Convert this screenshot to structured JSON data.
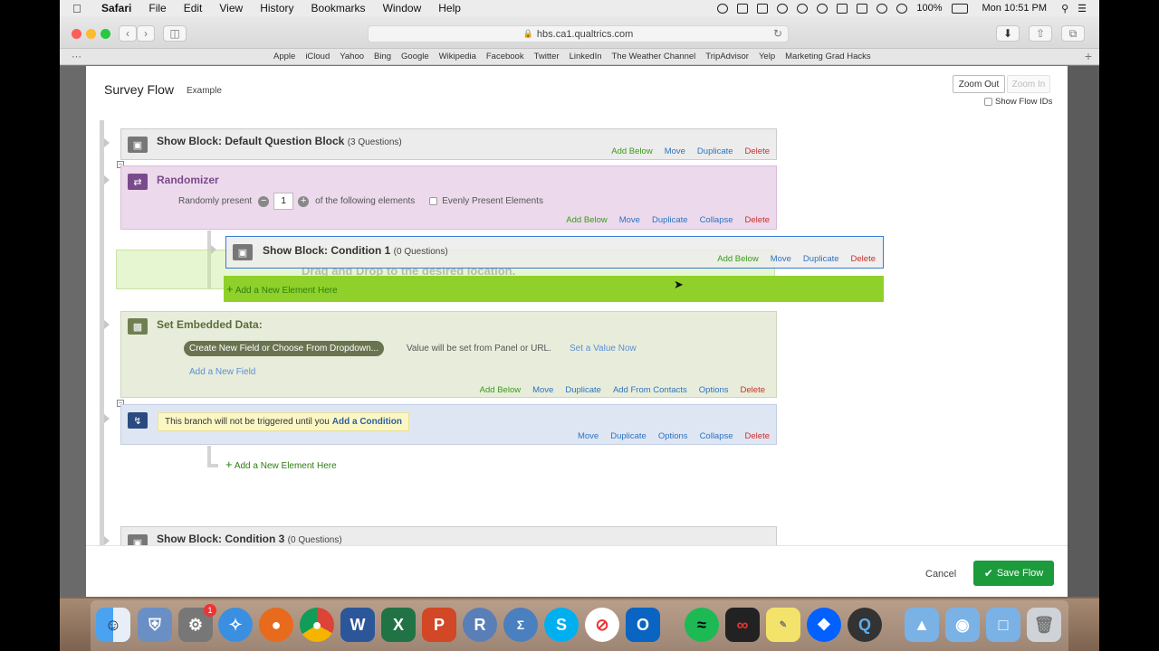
{
  "menubar": {
    "app": "Safari",
    "items": [
      "File",
      "Edit",
      "View",
      "History",
      "Bookmarks",
      "Window",
      "Help"
    ],
    "battery": "100%",
    "clock": "Mon 10:51 PM"
  },
  "browser": {
    "url": "hbs.ca1.qualtrics.com",
    "favorites": [
      "Apple",
      "iCloud",
      "Yahoo",
      "Bing",
      "Google",
      "Wikipedia",
      "Facebook",
      "Twitter",
      "LinkedIn",
      "The Weather Channel",
      "TripAdvisor",
      "Yelp",
      "Marketing Grad Hacks"
    ]
  },
  "modal": {
    "title": "Survey Flow",
    "subtitle": "Example",
    "zoom_out": "Zoom Out",
    "zoom_in": "Zoom In",
    "show_flow_ids": "Show Flow IDs",
    "cancel": "Cancel",
    "save": "Save Flow"
  },
  "flow": {
    "default_block": {
      "title": "Show Block: Default Question Block",
      "count": "(3 Questions)",
      "actions": [
        "Add Below",
        "Move",
        "Duplicate",
        "Delete"
      ]
    },
    "randomizer": {
      "title": "Randomizer",
      "present_label": "Randomly present",
      "present_value": "1",
      "following": "of the following elements",
      "evenly": "Evenly Present Elements",
      "actions": [
        "Add Below",
        "Move",
        "Duplicate",
        "Collapse",
        "Delete"
      ]
    },
    "condition1": {
      "title": "Show Block: Condition 1",
      "count": "(0 Questions)",
      "actions": [
        "Add Below",
        "Move",
        "Duplicate",
        "Delete"
      ],
      "drag_hint": "Drag and Drop to the desired location."
    },
    "add_element": "Add a New Element Here",
    "embedded": {
      "title": "Set Embedded Data:",
      "field_pill": "Create New Field or Choose From Dropdown...",
      "value_text": "Value will be set from Panel or URL.",
      "set_value": "Set a Value Now",
      "add_field": "Add a New Field",
      "actions": [
        "Add Below",
        "Move",
        "Duplicate",
        "Add From Contacts",
        "Options",
        "Delete"
      ]
    },
    "branch": {
      "notice": "This branch will not be triggered until you",
      "add_condition": "Add a Condition",
      "actions": [
        "Move",
        "Duplicate",
        "Options",
        "Collapse",
        "Delete"
      ]
    },
    "add_element_2": "Add a New Element Here",
    "condition3": {
      "title": "Show Block: Condition 3",
      "count": "(0 Questions)"
    }
  },
  "dock": {
    "badge": "1"
  },
  "colors": {
    "randomizer_bg": "#ecd9ec",
    "embedded_bg": "#e8eddb",
    "branch_bg": "#dfe6f3",
    "drop_green": "#8fd12a",
    "save_green": "#1c9b3c"
  }
}
